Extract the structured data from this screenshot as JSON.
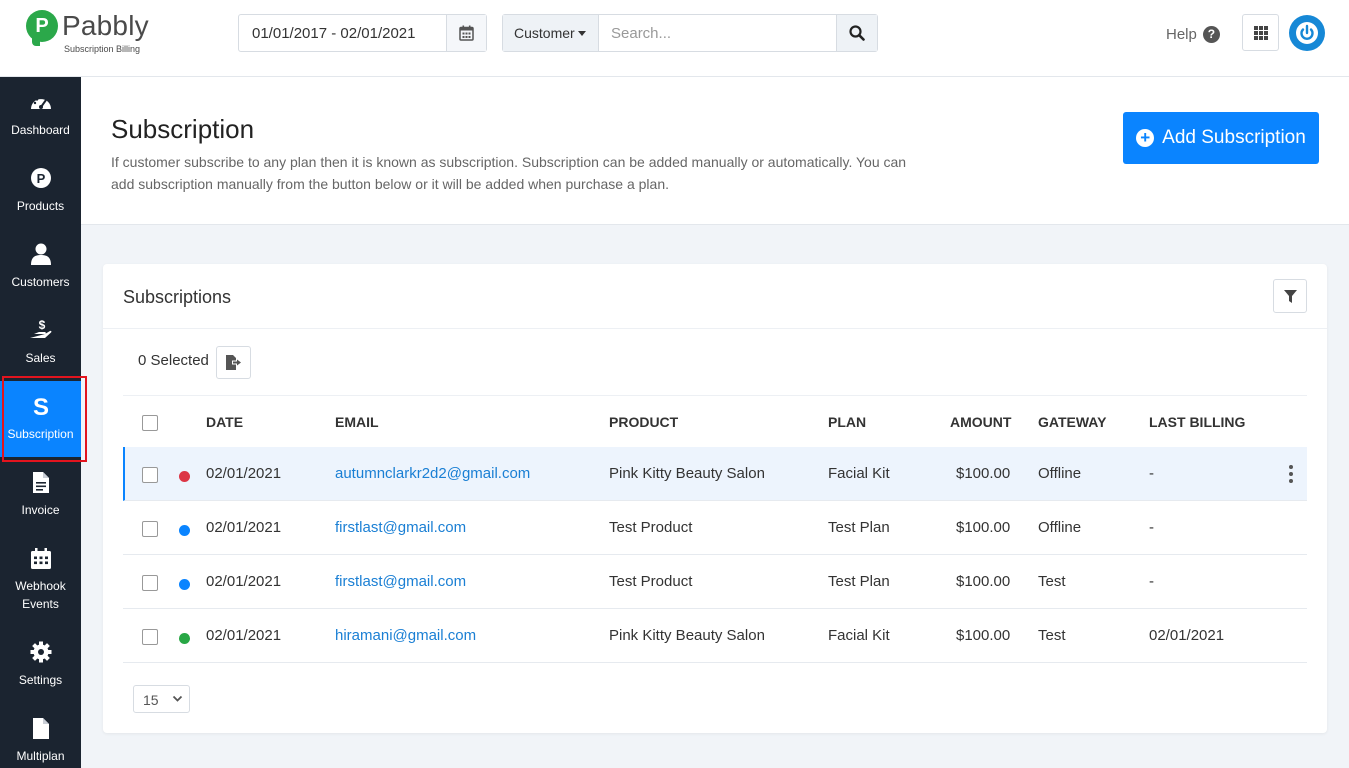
{
  "app": {
    "logo_text": "Pabbly",
    "logo_sub": "Subscription Billing",
    "logo_letter": "P"
  },
  "topbar": {
    "date_range": "01/01/2017 - 02/01/2021",
    "search_filter": "Customer",
    "search_placeholder": "Search...",
    "help_label": "Help",
    "help_symbol": "?"
  },
  "sidebar": {
    "items": [
      {
        "label": "Dashboard",
        "icon": "dashboard-gauge-icon"
      },
      {
        "label": "Products",
        "icon": "products-p-icon"
      },
      {
        "label": "Customers",
        "icon": "user-icon"
      },
      {
        "label": "Sales",
        "icon": "hand-dollar-icon"
      },
      {
        "label": "Subscription",
        "icon": "subscription-s-icon",
        "active": true
      },
      {
        "label": "Invoice",
        "icon": "invoice-file-icon"
      },
      {
        "label": "Webhook Events",
        "icon": "calendar-icon"
      },
      {
        "label": "Settings",
        "icon": "gear-icon"
      },
      {
        "label": "Multiplan",
        "icon": "file-icon"
      }
    ]
  },
  "header": {
    "title": "Subscription",
    "description": "If customer subscribe to any plan then it is known as subscription. Subscription can be added manually or automatically. You can add subscription manually from the button below or it will be added when purchase a plan.",
    "add_button": "Add Subscription"
  },
  "card": {
    "title": "Subscriptions",
    "selected_text": "0 Selected",
    "columns": [
      "DATE",
      "EMAIL",
      "PRODUCT",
      "PLAN",
      "AMOUNT",
      "GATEWAY",
      "LAST BILLING"
    ],
    "rows": [
      {
        "status_color": "#dc3545",
        "date": "02/01/2021",
        "email": "autumnclarkr2d2@gmail.com",
        "product": "Pink Kitty Beauty Salon",
        "plan": "Facial Kit",
        "amount": "$100.00",
        "gateway": "Offline",
        "last_billing": "-"
      },
      {
        "status_color": "#0a84ff",
        "date": "02/01/2021",
        "email": "firstlast@gmail.com",
        "product": "Test Product",
        "plan": "Test Plan",
        "amount": "$100.00",
        "gateway": "Offline",
        "last_billing": "-"
      },
      {
        "status_color": "#0a84ff",
        "date": "02/01/2021",
        "email": "firstlast@gmail.com",
        "product": "Test Product",
        "plan": "Test Plan",
        "amount": "$100.00",
        "gateway": "Test",
        "last_billing": "-"
      },
      {
        "status_color": "#28a745",
        "date": "02/01/2021",
        "email": "hiramani@gmail.com",
        "product": "Pink Kitty Beauty Salon",
        "plan": "Facial Kit",
        "amount": "$100.00",
        "gateway": "Test",
        "last_billing": "02/01/2021"
      }
    ],
    "page_size": "15"
  },
  "colors": {
    "accent": "#0a84ff",
    "sidebar_bg": "#1b2430",
    "brand_green": "#2ba84a"
  }
}
